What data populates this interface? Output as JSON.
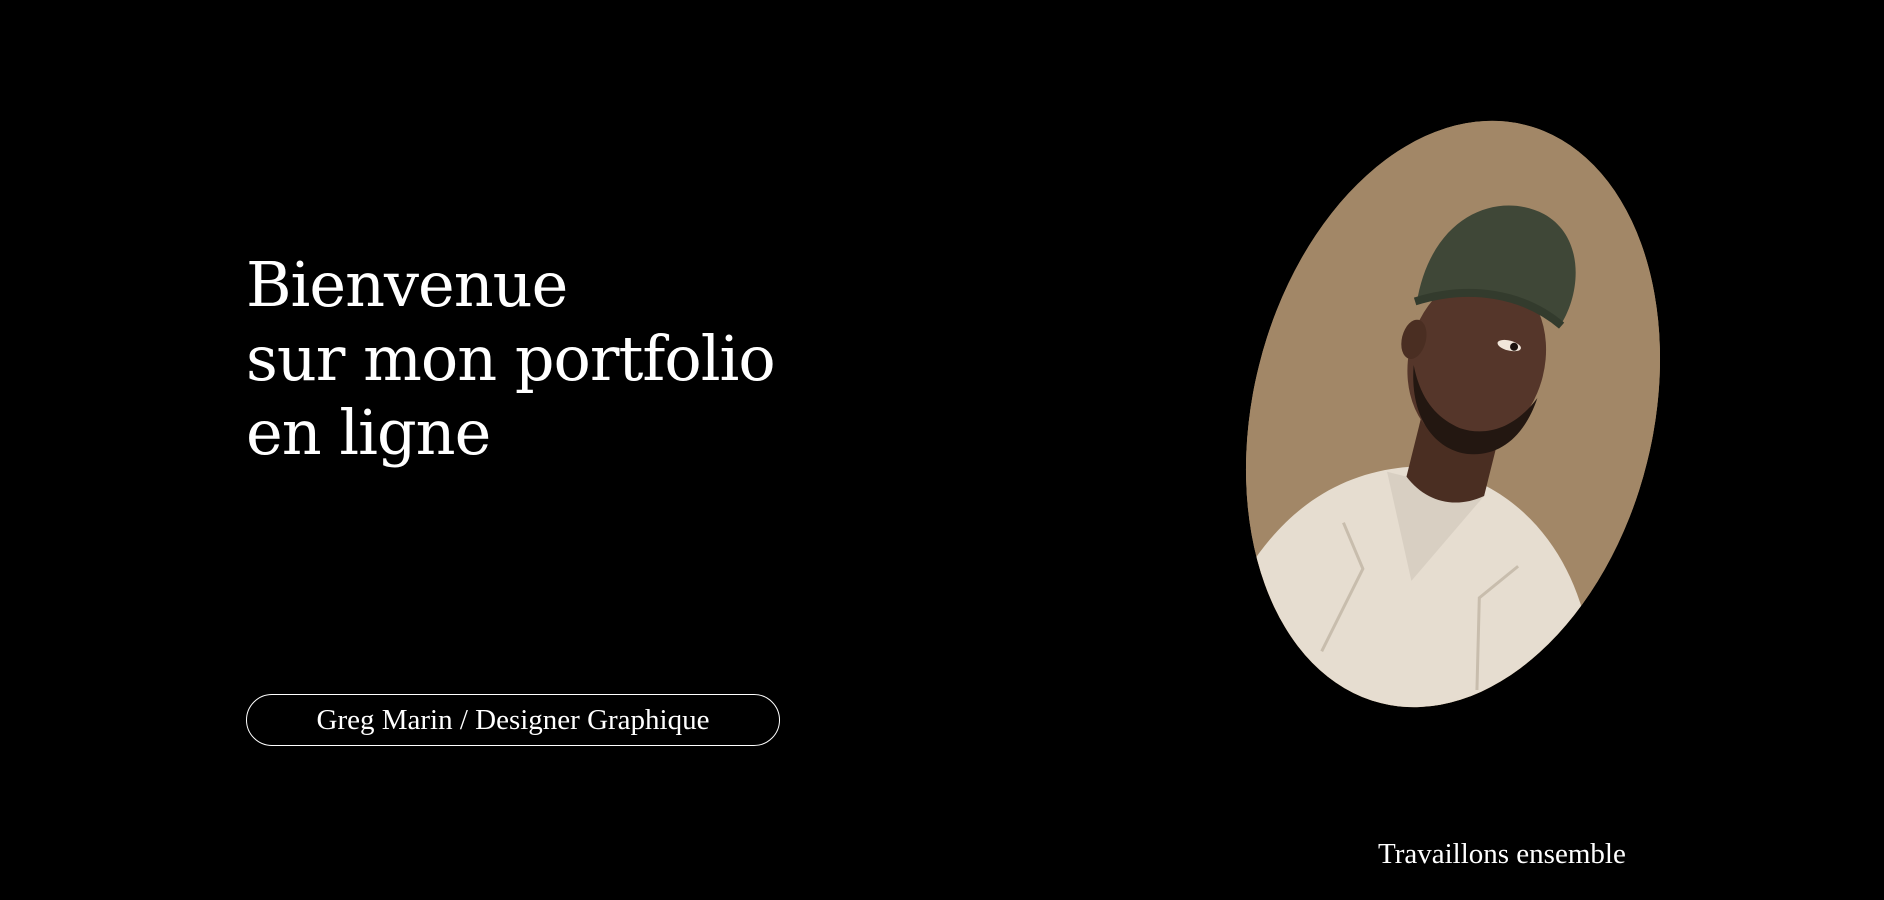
{
  "hero": {
    "headline_lines": [
      "Bienvenue",
      "sur mon portfolio",
      "en ligne"
    ],
    "name_badge": "Greg Marin / Designer Graphique"
  },
  "portrait": {
    "icon": "person-portrait-photo",
    "background_color": "#9c8262",
    "hat_color": "#3f4737",
    "jacket_color": "#e6ddd0"
  },
  "footer": {
    "cta_label": "Travaillons ensemble"
  },
  "colors": {
    "background": "#000000",
    "text": "#ffffff"
  }
}
